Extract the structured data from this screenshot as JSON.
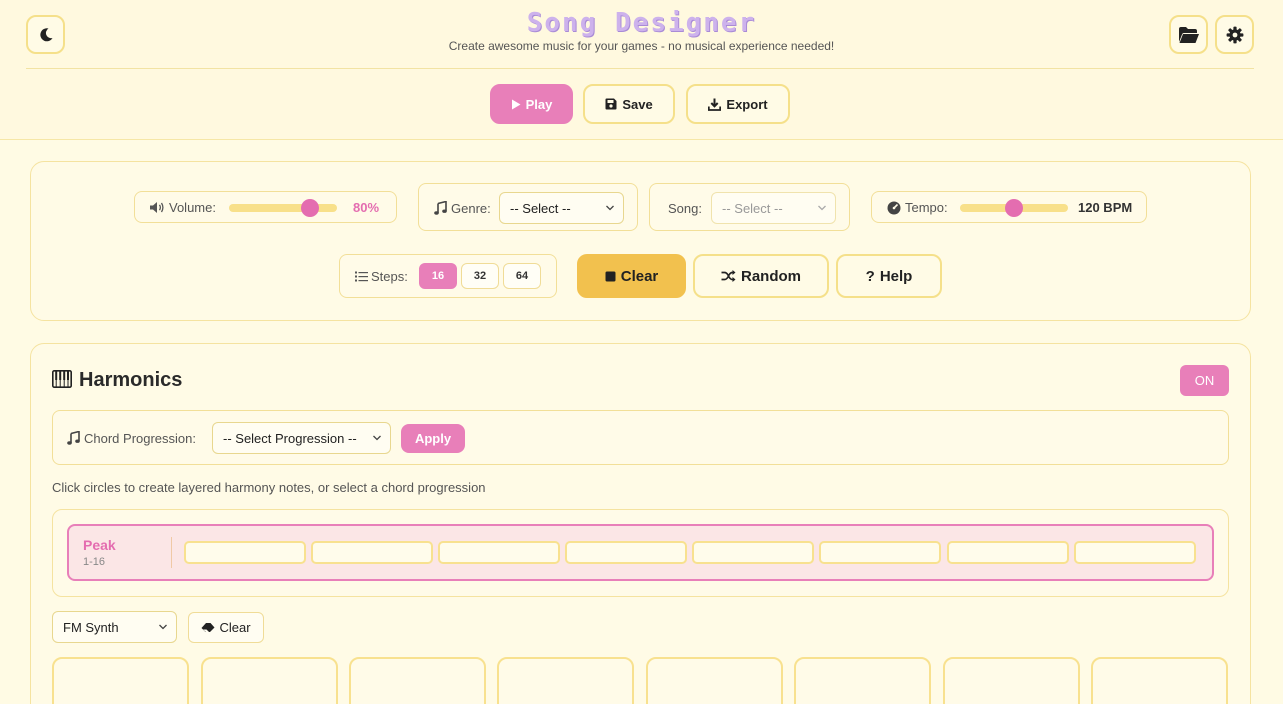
{
  "header": {
    "title": "Song Designer",
    "subtitle": "Create awesome music for your games - no musical experience needed!",
    "icons": {
      "theme": "moon-icon",
      "open": "folder-open-icon",
      "settings": "gear-icon"
    }
  },
  "toolbar": {
    "play_label": "Play",
    "save_label": "Save",
    "export_label": "Export"
  },
  "controls": {
    "volume_label": "Volume:",
    "volume_value": "80%",
    "volume_level": 0.8,
    "genre_label": "Genre:",
    "genre_selected": "-- Select --",
    "song_label": "Song:",
    "song_selected": "-- Select --",
    "tempo_label": "Tempo:",
    "tempo_value": "120 BPM",
    "tempo_level": 0.5,
    "steps_label": "Steps:",
    "steps": [
      "16",
      "32",
      "64"
    ],
    "steps_active": "16",
    "clear_label": "Clear",
    "random_label": "Random",
    "help_label": "Help"
  },
  "harmonics": {
    "title": "Harmonics",
    "toggle_label": "ON",
    "chord_label": "Chord Progression:",
    "chord_selected": "-- Select Progression --",
    "apply_label": "Apply",
    "hint": "Click circles to create layered harmony notes, or select a chord progression",
    "peak_label": "Peak",
    "peak_range": "1-16",
    "synth_selected": "FM Synth",
    "clear_label": "Clear"
  },
  "colors": {
    "background": "#fffbe4",
    "accent_pink": "#e87fb9",
    "accent_yellow": "#f2c14e",
    "border_yellow": "#f5e08a",
    "title_lavender": "#cdb2ec"
  }
}
